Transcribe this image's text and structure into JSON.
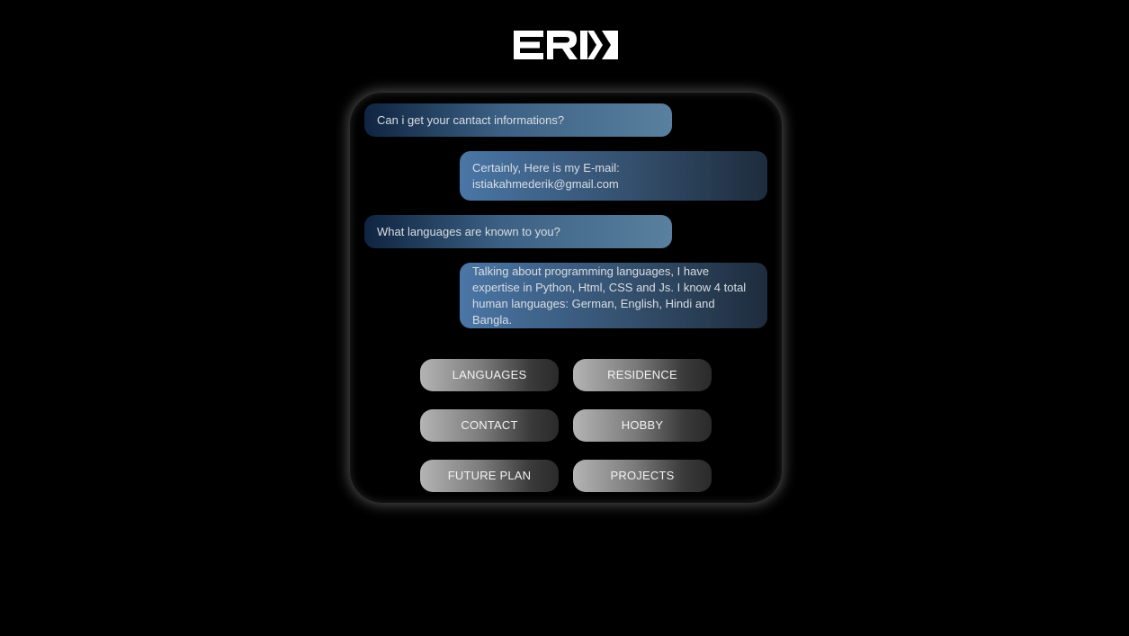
{
  "logo": {
    "text": "ERK",
    "color": "#ffffff"
  },
  "chat": [
    {
      "role": "question",
      "text": "Can i get your cantact informations?"
    },
    {
      "role": "answer",
      "lines": [
        "Certainly, Here is my E-mail:",
        "istiakahmederik@gmail.com"
      ]
    },
    {
      "role": "question",
      "text": "What languages are known to you?"
    },
    {
      "role": "answer",
      "lines": [
        "Talking about programming languages, I have",
        "expertise in Python, Html, CSS and Js. I know 4 total",
        "human languages: German, English, Hindi and Bangla."
      ]
    }
  ],
  "buttons": {
    "languages": "LANGUAGES",
    "residence": "RESIDENCE",
    "contact": "CONTACT",
    "hobby": "HOBBY",
    "future_plan": "FUTURE PLAN",
    "projects": "PROJECTS"
  },
  "colors": {
    "background": "#000000",
    "question_bubble": "#3c6184",
    "answer_bubble": "#4a76a6",
    "button": "#7a7a7a"
  }
}
